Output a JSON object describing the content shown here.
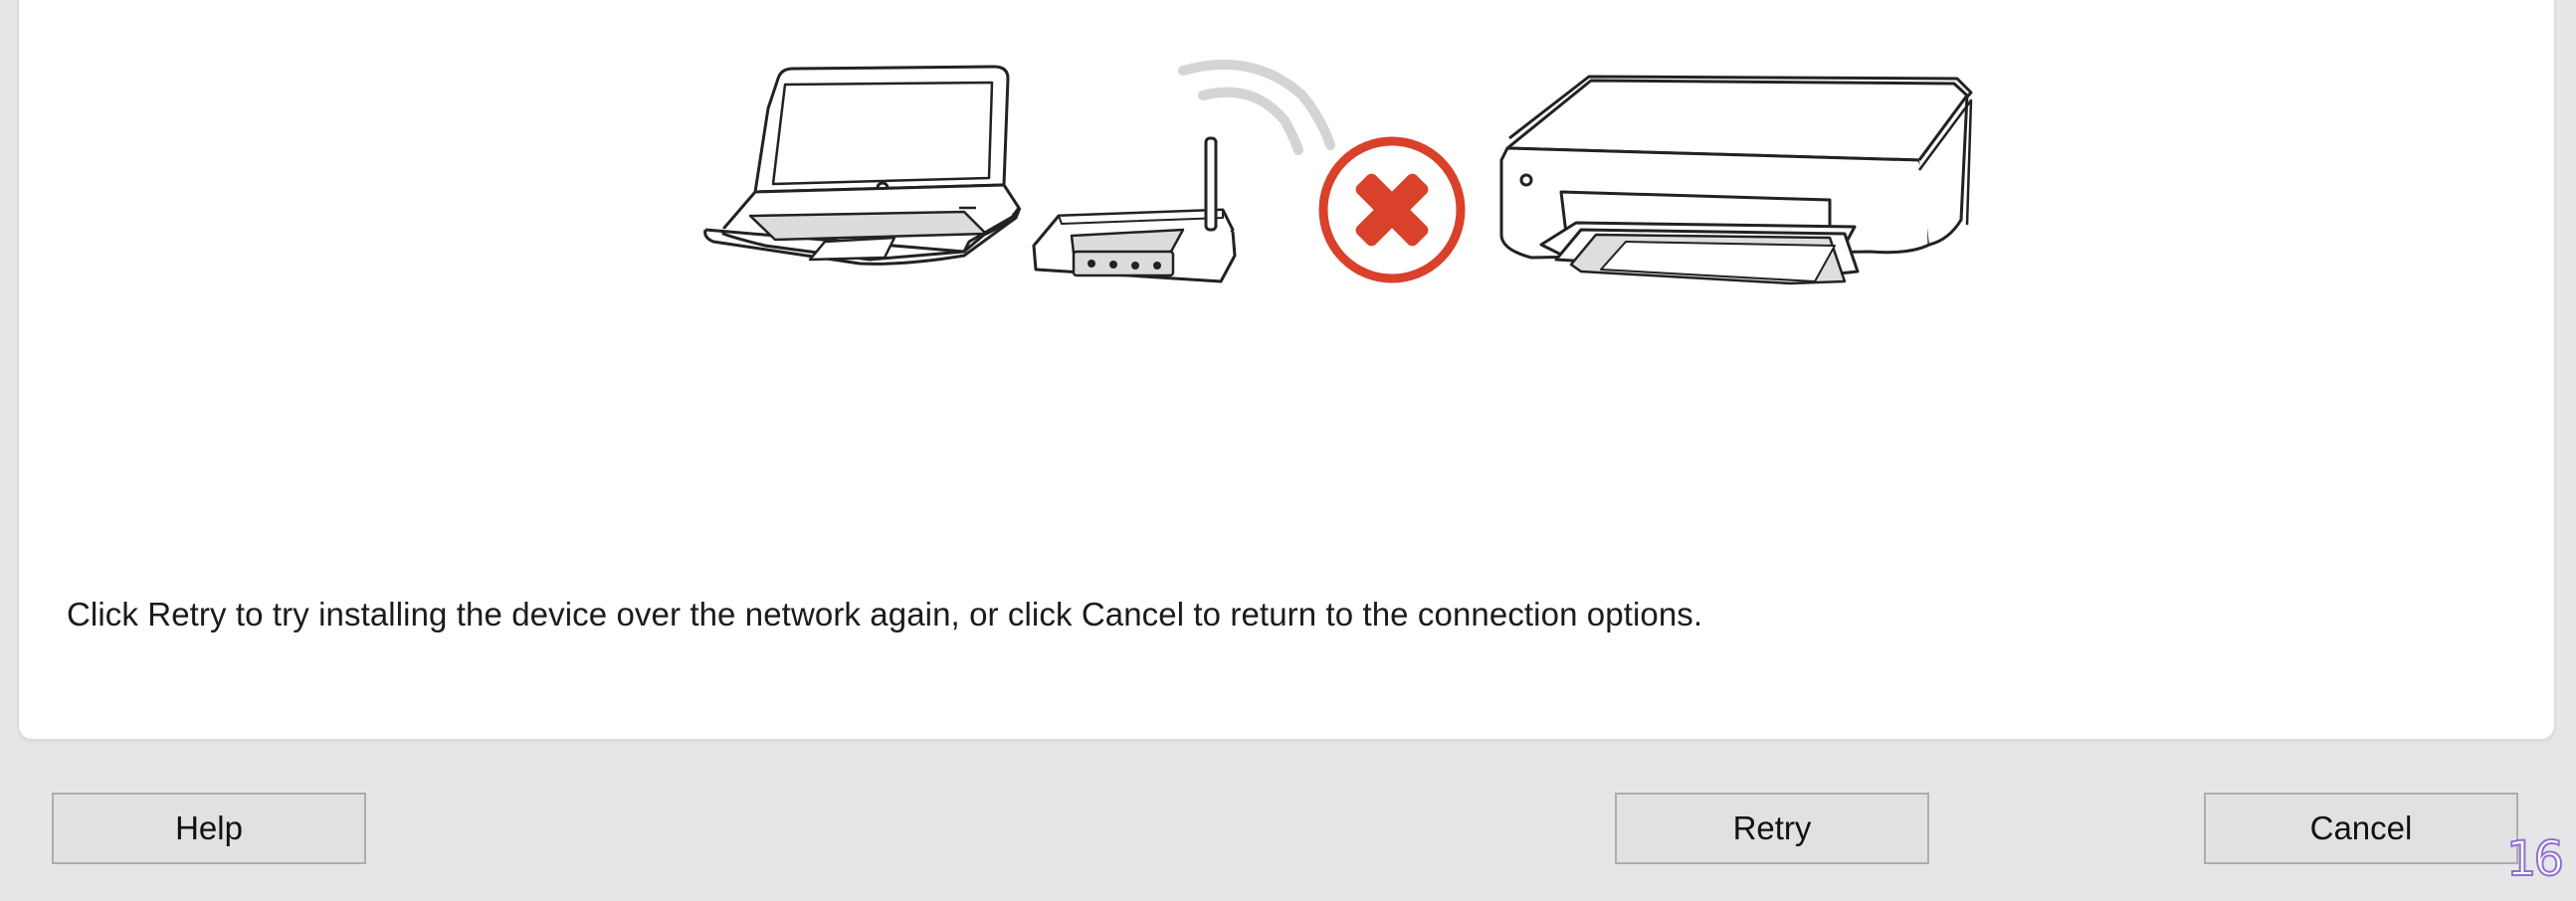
{
  "dialog": {
    "illustration": {
      "laptop": "laptop-icon",
      "router": "router-icon",
      "signal": "wifi-signal-icon",
      "error": "error-x-icon",
      "printer": "printer-icon",
      "error_color": "#d9412a"
    },
    "message": "Click Retry to try installing the device over the network again, or click Cancel to return to the connection options."
  },
  "footer": {
    "help_label": "Help",
    "retry_label": "Retry",
    "cancel_label": "Cancel"
  },
  "page_number": "16"
}
